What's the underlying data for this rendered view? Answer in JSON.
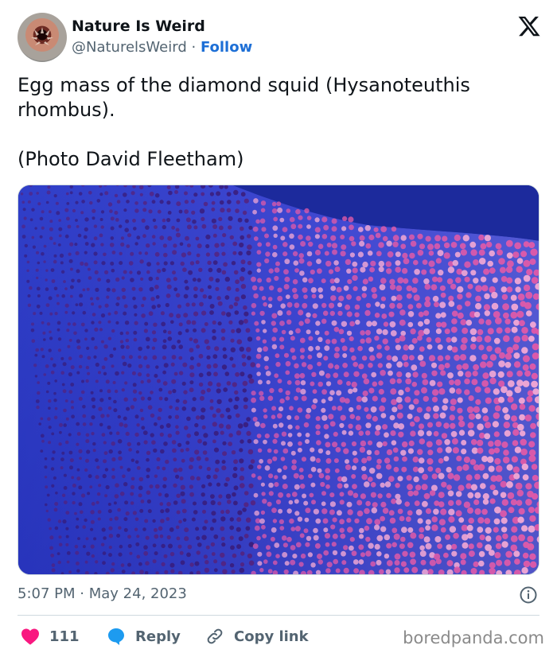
{
  "author": {
    "name": "Nature Is Weird",
    "handle": "@NaturelsWeird",
    "separator": "·",
    "follow_label": "Follow"
  },
  "tweet": {
    "line1": "Egg mass of the diamond squid (Hysanoteuthis rhombus).",
    "line2": "(Photo David Fleetham)"
  },
  "media": {
    "description_icon": "photo"
  },
  "meta": {
    "time": "5:07 PM",
    "separator": "·",
    "date": "May 24, 2023"
  },
  "actions": {
    "likes": "111",
    "reply_label": "Reply",
    "copy_label": "Copy link"
  },
  "credit": "boredpanda.com",
  "colors": {
    "like": "#f91880",
    "reply": "#1d9bf0",
    "follow": "#1d6fd6",
    "water": "#1b2aa0"
  }
}
